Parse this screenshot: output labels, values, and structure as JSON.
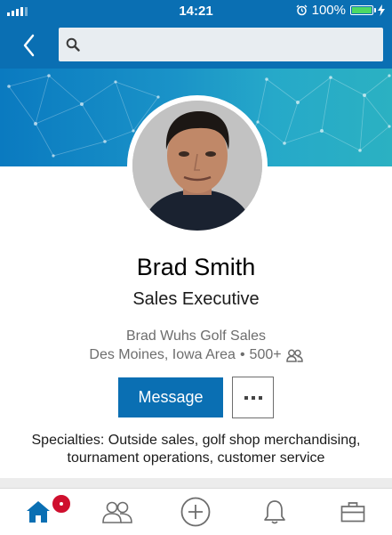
{
  "status_bar": {
    "time": "14:21",
    "battery_text": "100%",
    "battery_level": 1.0,
    "icons": [
      "signal-icon",
      "alarm-icon",
      "battery-icon",
      "charging-icon"
    ]
  },
  "header": {
    "back_icon": "chevron-left-icon",
    "search_icon": "search-icon",
    "search_value": "",
    "search_placeholder": ""
  },
  "profile": {
    "name": "Brad Smith",
    "headline": "Sales Executive",
    "company": "Brad Wuhs Golf Sales",
    "location": "Des Moines, Iowa Area",
    "separator": "•",
    "connections": "500+",
    "message_label": "Message",
    "specialties": "Specialties: Outside sales, golf shop merchandising, tournament operations, customer service"
  },
  "bottom_nav": {
    "items": [
      {
        "icon": "home-icon",
        "active": true
      },
      {
        "icon": "network-icon",
        "active": false
      },
      {
        "icon": "post-icon",
        "active": false
      },
      {
        "icon": "notifications-icon",
        "active": false
      },
      {
        "icon": "jobs-icon",
        "active": false
      }
    ],
    "home_badge": true
  },
  "colors": {
    "brand_blue": "#0a6fb3",
    "badge_red": "#cf0f2e",
    "battery_green": "#4cd964",
    "text_gray": "#6d6d6d"
  }
}
